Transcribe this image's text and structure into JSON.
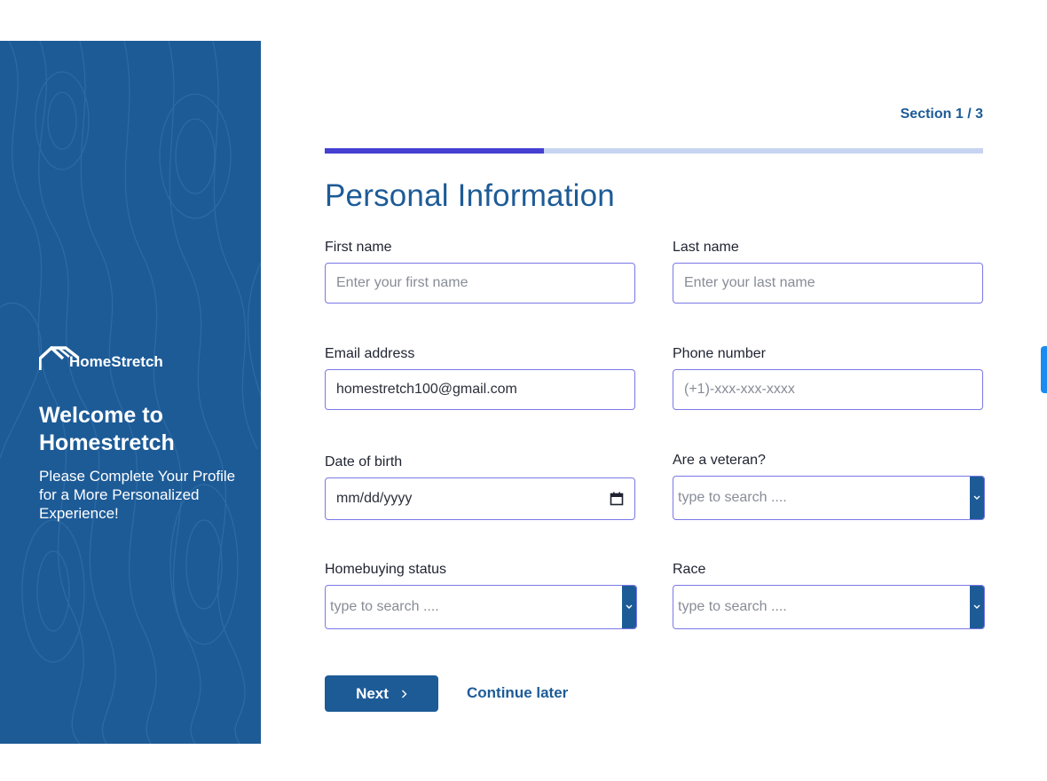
{
  "brand": {
    "name": "HomeStretch",
    "logo_icon": "house-roof-icon"
  },
  "sidebar": {
    "welcome": "Welcome to Homestretch",
    "tagline": "Please Complete Your Profile for a More Personalized Experience!"
  },
  "progress": {
    "section_label": "Section 1 / 3",
    "current": 1,
    "total": 3,
    "fraction": 0.333
  },
  "form": {
    "title": "Personal Information",
    "first_name": {
      "label": "First name",
      "placeholder": "Enter your first name"
    },
    "last_name": {
      "label": "Last name",
      "placeholder": "Enter your last name"
    },
    "email": {
      "label": "Email address",
      "value": "homestretch100@gmail.com"
    },
    "phone": {
      "label": "Phone number",
      "placeholder": "(+1)-xxx-xxx-xxxx"
    },
    "dob": {
      "label": "Date of birth",
      "placeholder": "mm/dd/yyyy",
      "icon": "calendar-icon"
    },
    "veteran": {
      "label": "Are a veteran?",
      "placeholder": "type to search ...."
    },
    "homebuying": {
      "label": "Homebuying status",
      "placeholder": "type to search ...."
    },
    "race": {
      "label": "Race",
      "placeholder": "type to search ...."
    }
  },
  "actions": {
    "next_label": "Next",
    "later_label": "Continue later"
  },
  "colors": {
    "brand_blue": "#1d5b97",
    "progress_fill": "#4540d2",
    "progress_track": "#c7d4f1",
    "input_border": "#7b78e6"
  }
}
